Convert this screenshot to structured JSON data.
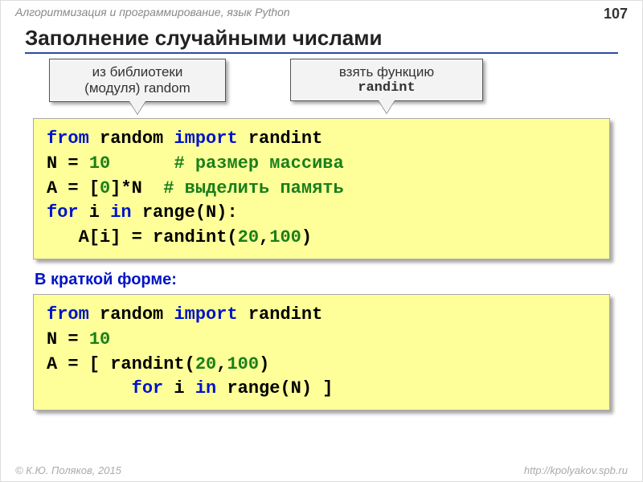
{
  "header": {
    "course": "Алгоритмизация и программирование, язык Python",
    "page": "107"
  },
  "title": "Заполнение случайными числами",
  "callout_left": {
    "line1": "из библиотеки",
    "line2": "(модуля) random"
  },
  "callout_right": {
    "line1": "взять функцию",
    "line2": "randint"
  },
  "code1": {
    "l1_from": "from",
    "l1_mod": " random ",
    "l1_import": "import",
    "l1_name": " randint",
    "l2a": "N = ",
    "l2b": "10",
    "l2pad": "      ",
    "l2c": "# размер массива",
    "l3a": "A = [",
    "l3b": "0",
    "l3c": "]*N  ",
    "l3d": "# выделить память",
    "l4_for": "for",
    "l4a": " i ",
    "l4_in": "in",
    "l4b": " range(N):",
    "l5": "   A[i] = randint(",
    "l5n1": "20",
    "l5comma": ",",
    "l5n2": "100",
    "l5end": ")"
  },
  "subhead": "В краткой форме:",
  "code2": {
    "l1_from": "from",
    "l1_mod": " random ",
    "l1_import": "import",
    "l1_name": " randint",
    "l2a": "N = ",
    "l2b": "10",
    "l3a": "A = [ randint(",
    "l3n1": "20",
    "l3comma": ",",
    "l3n2": "100",
    "l3end": ")",
    "l4pad": "        ",
    "l4_for": "for",
    "l4a": " i ",
    "l4_in": "in",
    "l4b": " range(N) ]"
  },
  "footer": {
    "left": "© К.Ю. Поляков, 2015",
    "right": "http://kpolyakov.spb.ru"
  }
}
